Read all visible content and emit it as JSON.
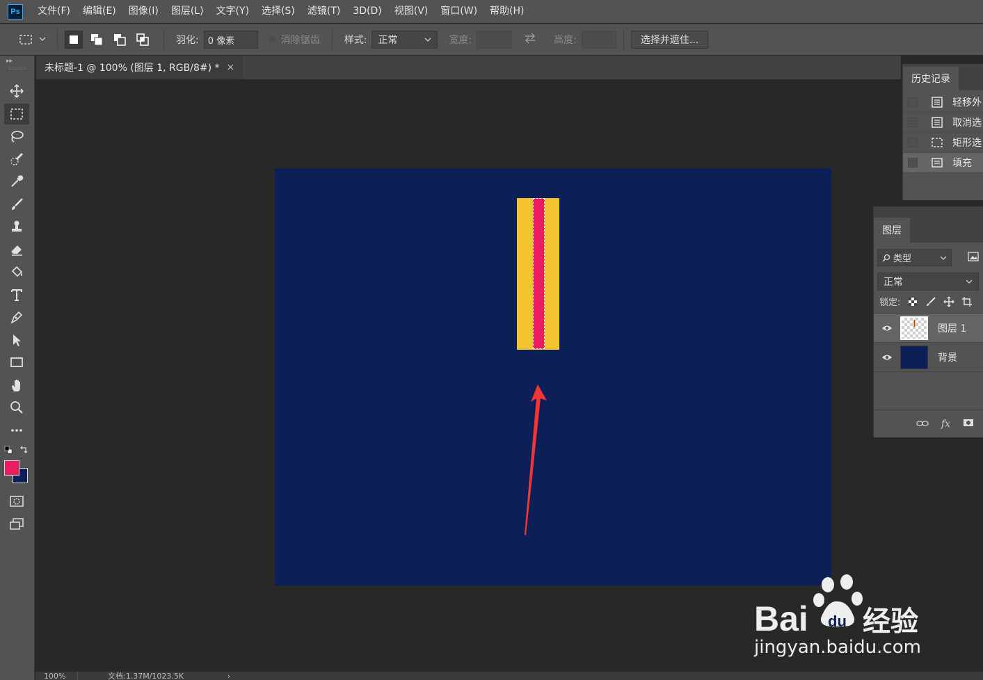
{
  "menubar": {
    "logo": "Ps",
    "items": [
      "文件(F)",
      "编辑(E)",
      "图像(I)",
      "图层(L)",
      "文字(Y)",
      "选择(S)",
      "滤镜(T)",
      "3D(D)",
      "视图(V)",
      "窗口(W)",
      "帮助(H)"
    ]
  },
  "options": {
    "feather_label": "羽化:",
    "feather_value": "0 像素",
    "antialias_label": "消除锯齿",
    "style_label": "样式:",
    "style_value": "正常",
    "width_label": "宽度:",
    "height_label": "高度:",
    "select_mask_button": "选择并遮住..."
  },
  "document": {
    "tab_title": "未标题-1 @ 100% (图层 1, RGB/8#) *",
    "close_glyph": "×",
    "background_color": "#0c2057",
    "yellow_color": "#f3c431",
    "pink_color": "#ec1d5f",
    "arrow_color": "#f23535"
  },
  "status": {
    "zoom": "100%",
    "doc_info": "文档:1.37M/1023.5K"
  },
  "colors": {
    "foreground": "#ec1d5f",
    "background": "#0c2057"
  },
  "history": {
    "tab_label": "历史记录",
    "items": [
      {
        "label": "轻移外",
        "icon": "document-icon",
        "selected": false
      },
      {
        "label": "取消选",
        "icon": "document-icon",
        "selected": false
      },
      {
        "label": "矩形选",
        "icon": "marquee-icon",
        "selected": false
      },
      {
        "label": "填充",
        "icon": "fill-icon",
        "selected": true
      }
    ]
  },
  "layers": {
    "tab_label": "图层",
    "filter_label": "类型",
    "blend_mode": "正常",
    "lock_label": "锁定:",
    "items": [
      {
        "name": "图层 1",
        "selected": true
      },
      {
        "name": "背景",
        "selected": false
      }
    ],
    "footer_fx": "fx"
  },
  "watermark": {
    "brand": "Bai du 经验",
    "url": "jingyan.baidu.com"
  }
}
